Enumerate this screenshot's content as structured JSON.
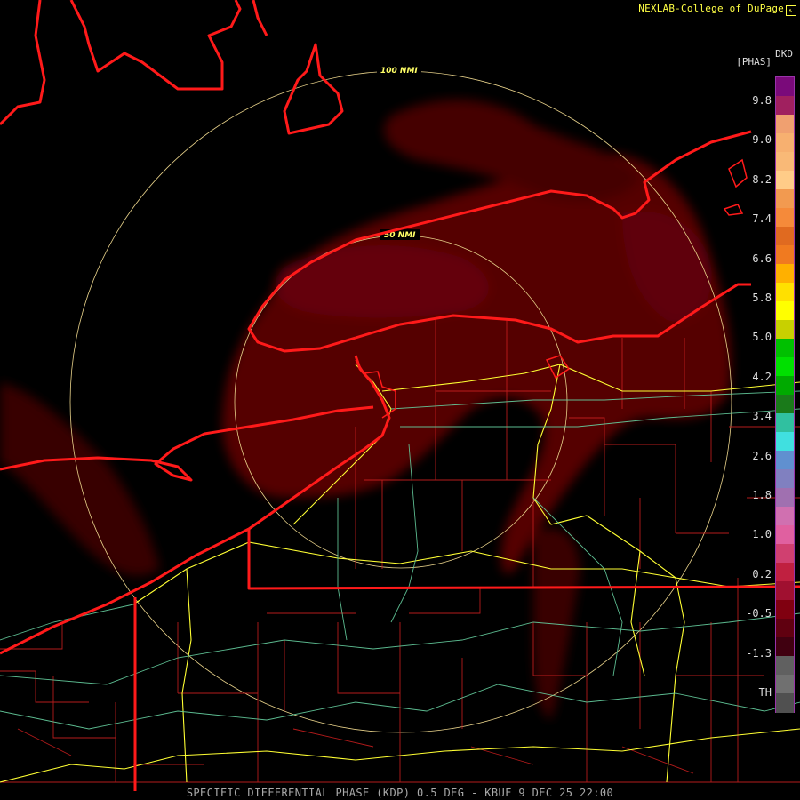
{
  "credit": "NEXLAB-College of DuPage",
  "product_code": "DKD",
  "unit_label": "[PHAS]",
  "ring_labels": [
    "100 NMI",
    "50 NMI"
  ],
  "scale_labels": [
    "9.8",
    "9.0",
    "8.2",
    "7.4",
    "6.6",
    "5.8",
    "5.0",
    "4.2",
    "3.4",
    "2.6",
    "1.8",
    "1.0",
    "0.2",
    "-0.5",
    "-1.3",
    "TH"
  ],
  "scale_colors": [
    "#7a0a7a",
    "#a0205f",
    "#f0a070",
    "#f7b070",
    "#f9b977",
    "#ffcc88",
    "#f29a50",
    "#f58a3a",
    "#e06a20",
    "#f07a20",
    "#ffb000",
    "#ffe000",
    "#ffff00",
    "#c8d000",
    "#00c000",
    "#00e000",
    "#00aa00",
    "#1a7a1a",
    "#30c0a0",
    "#40e0e0",
    "#6090d0",
    "#8080c0",
    "#a070b0",
    "#d070b0",
    "#e060a0",
    "#d04070",
    "#c02040",
    "#a01030",
    "#800010",
    "#600010",
    "#400010",
    "#606060",
    "#707070",
    "#505050"
  ],
  "footer": "SPECIFIC DIFFERENTIAL PHASE (KDP) 0.5 DEG - KBUF 9 DEC 25 22:00"
}
